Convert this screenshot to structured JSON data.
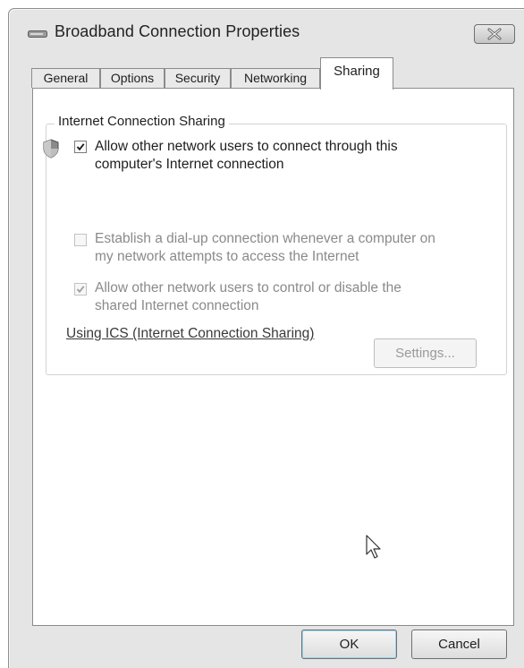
{
  "window": {
    "title": "Broadband Connection Properties",
    "close_label": "Close"
  },
  "tabs": [
    {
      "label": "General"
    },
    {
      "label": "Options"
    },
    {
      "label": "Security"
    },
    {
      "label": "Networking"
    },
    {
      "label": "Sharing"
    }
  ],
  "active_tab": "Sharing",
  "sharing": {
    "group_label": "Internet Connection Sharing",
    "allow_connect": {
      "line1": "Allow other network users to connect through this",
      "line2": "computer's Internet connection",
      "checked": true
    },
    "dial_up": {
      "line1": "Establish a dial-up connection whenever a computer on",
      "line2": "my network attempts to access the Internet",
      "checked": false,
      "enabled": false
    },
    "allow_control": {
      "line1": "Allow other network users to control or disable the",
      "line2": "shared Internet connection",
      "checked": true,
      "enabled": false
    },
    "ics_link": "Using ICS (Internet Connection Sharing)",
    "settings_button": "Settings..."
  },
  "buttons": {
    "ok": "OK",
    "cancel": "Cancel"
  }
}
